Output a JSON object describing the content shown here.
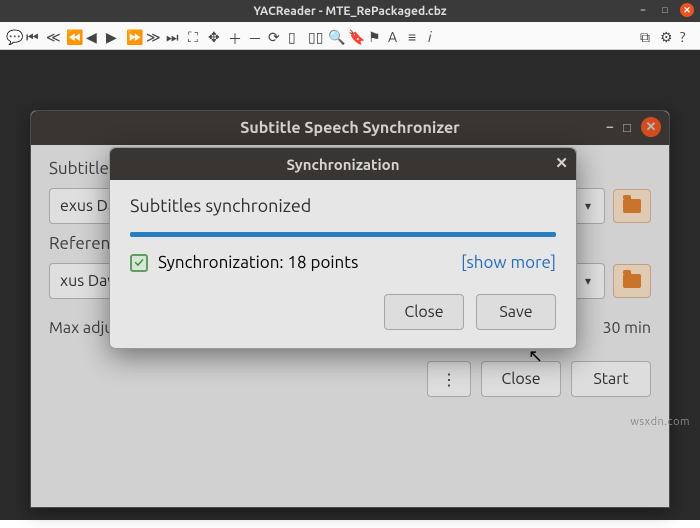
{
  "app": {
    "title": "YACReader - MTE_RePackaged.cbz"
  },
  "sss": {
    "title": "Subtitle Speech Synchronizer",
    "subtitles_label": "Subtitles:",
    "subtitles_value": "exus Dawn",
    "references_label": "References:",
    "references_value": "xus Dawn",
    "max_label": "Max adjust",
    "max_value": "30 min",
    "buttons": {
      "more": "⋮",
      "close": "Close",
      "start": "Start"
    }
  },
  "modal": {
    "title": "Synchronization",
    "message": "Subtitles synchronized",
    "result": "Synchronization: 18 points",
    "show_more": "[show more]",
    "buttons": {
      "close": "Close",
      "save": "Save"
    }
  },
  "watermark": "wsxdn.com"
}
